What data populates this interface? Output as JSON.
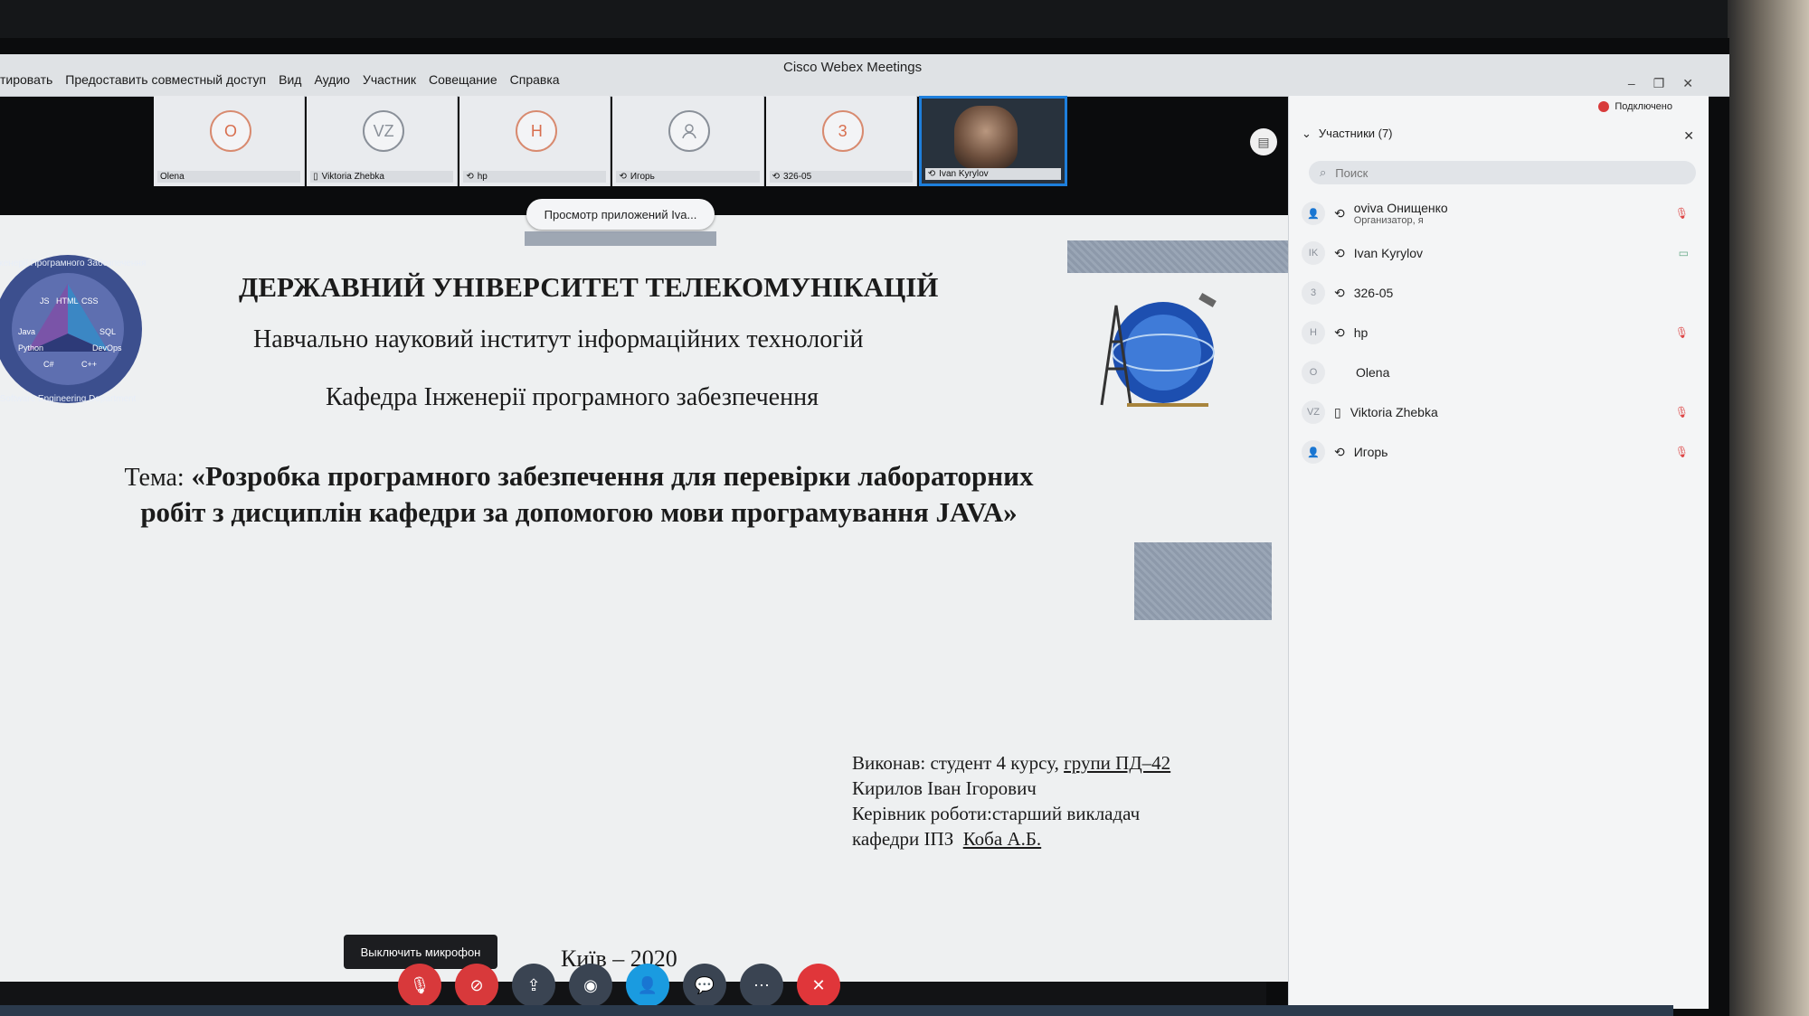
{
  "window": {
    "title": "Cisco Webex Meetings",
    "menu": [
      "тировать",
      "Предоставить совместный доступ",
      "Вид",
      "Аудио",
      "Участник",
      "Совещание",
      "Справка"
    ],
    "controls": [
      "–",
      "❐",
      "✕"
    ]
  },
  "video_strip": [
    {
      "initials": "O",
      "name": "Olena"
    },
    {
      "initials": "VZ",
      "name": "Viktoria Zhebka"
    },
    {
      "initials": "H",
      "name": "hp"
    },
    {
      "initials": "",
      "name": "Игорь"
    },
    {
      "initials": "3",
      "name": "326-05"
    },
    {
      "initials": "",
      "name": "Ivan Kyrylov",
      "video": true
    }
  ],
  "viewing_label": "Просмотр приложений Iva...",
  "slide": {
    "university": "ДЕРЖАВНИЙ УНІВЕРСИТЕТ ТЕЛЕКОМУНІКАЦІЙ",
    "institute": "Навчально науковий інститут інформаційних технологій",
    "department": "Кафедра Інженерії програмного забезпечення",
    "topic_lead": "Тема:",
    "topic": "«Розробка програмного забезпечення для перевірки лабораторних робіт з дисциплін кафедри за допомогою мови програмування JAVA»",
    "author_line1": "Виконав: студент 4 курсу,",
    "author_group": "групи ПД–42",
    "author_line2": "Кирилов Іван Ігорович",
    "supervisor_line1": "Керівник роботи:старший викладач",
    "supervisor_line2": "кафедри ІПЗ",
    "supervisor_name": "Коба А.Б.",
    "city": "Київ – 2020",
    "logo_left_text": [
      "Інженерії Програмного Забезпечення",
      "Software Engineering Department",
      "JS",
      "HTML",
      "CSS",
      "Java",
      "SQL",
      "Python",
      "DevOps",
      "C#",
      "C++"
    ]
  },
  "tooltip": "Выключить микрофон",
  "controls": [
    {
      "icon": "mic-off-icon",
      "color": "#d8393b"
    },
    {
      "icon": "video-off-icon",
      "color": "#d8393b"
    },
    {
      "icon": "share-icon",
      "color": "#3a4452"
    },
    {
      "icon": "record-icon",
      "color": "#3a4452"
    },
    {
      "icon": "participants-icon",
      "color": "#1a9be0"
    },
    {
      "icon": "chat-icon",
      "color": "#3a4452"
    },
    {
      "icon": "more-icon",
      "color": "#3a4452"
    },
    {
      "icon": "end-call-icon",
      "color": "#e0363a"
    }
  ],
  "panel": {
    "status": "Подключено",
    "header": "Участники (7)",
    "search_placeholder": "Поиск",
    "participants": [
      {
        "initials": "",
        "name": "oviva Онищенко",
        "sub": "Организатор, я",
        "muted": true
      },
      {
        "initials": "IK",
        "name": "Ivan Kyrylov",
        "sub": "",
        "muted": false
      },
      {
        "initials": "3",
        "name": "326-05",
        "sub": "",
        "muted": false
      },
      {
        "initials": "H",
        "name": "hp",
        "sub": "",
        "muted": true
      },
      {
        "initials": "O",
        "name": "Olena",
        "sub": "",
        "muted": false
      },
      {
        "initials": "VZ",
        "name": "Viktoria Zhebka",
        "sub": "",
        "muted": true
      },
      {
        "initials": "",
        "name": "Игорь",
        "sub": "",
        "muted": true
      }
    ]
  }
}
